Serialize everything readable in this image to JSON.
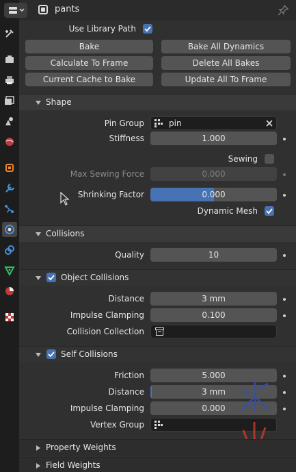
{
  "header": {
    "object_name": "pants"
  },
  "cache": {
    "use_library_path_label": "Use Library Path",
    "use_library_path_checked": true,
    "buttons": {
      "bake": "Bake",
      "bake_all_dynamics": "Bake All Dynamics",
      "calculate_to_frame": "Calculate To Frame",
      "delete_all_bakes": "Delete All Bakes",
      "current_cache_to_bake": "Current Cache to Bake",
      "update_all_to_frame": "Update All To Frame"
    }
  },
  "shape": {
    "title": "Shape",
    "pin_group_label": "Pin Group",
    "pin_group_value": "pin",
    "stiffness_label": "Stiffness",
    "stiffness_value": "1.000",
    "sewing_label": "Sewing",
    "sewing_checked": false,
    "max_sewing_force_label": "Max Sewing Force",
    "max_sewing_force_value": "0.000",
    "shrinking_factor_label": "Shrinking Factor",
    "shrinking_factor_value": "0.000",
    "shrinking_factor_fill": 0.5,
    "dynamic_mesh_label": "Dynamic Mesh",
    "dynamic_mesh_checked": true
  },
  "collisions": {
    "title": "Collisions",
    "quality_label": "Quality",
    "quality_value": "10",
    "object_collisions": {
      "title": "Object Collisions",
      "enabled": true,
      "distance_label": "Distance",
      "distance_value": "3 mm",
      "impulse_clamping_label": "Impulse Clamping",
      "impulse_clamping_value": "0.100",
      "collision_collection_label": "Collision Collection"
    },
    "self_collisions": {
      "title": "Self Collisions",
      "enabled": true,
      "friction_label": "Friction",
      "friction_value": "5.000",
      "distance_label": "Distance",
      "distance_value": "3 mm",
      "impulse_clamping_label": "Impulse Clamping",
      "impulse_clamping_value": "0.000",
      "vertex_group_label": "Vertex Group"
    }
  },
  "property_weights": {
    "title": "Property Weights"
  },
  "field_weights": {
    "title": "Field Weights"
  },
  "icons": {
    "tabs": [
      "tool-icon",
      "render-icon",
      "output-icon",
      "view-layer-icon",
      "scene-icon",
      "world-icon",
      "object-icon",
      "modifier-icon",
      "particles-icon",
      "physics-icon",
      "constraints-icon",
      "object-data-icon",
      "material-icon",
      "texture-icon"
    ]
  },
  "colors": {
    "accent": "#4772b3",
    "background": "#303030",
    "field": "#545454"
  }
}
